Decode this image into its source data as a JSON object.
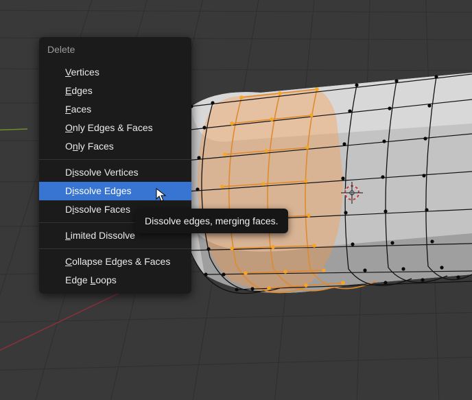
{
  "menu": {
    "title": "Delete",
    "groups": [
      [
        {
          "label": "Vertices",
          "u": [
            0,
            1
          ]
        },
        {
          "label": "Edges",
          "u": [
            0,
            1
          ]
        },
        {
          "label": "Faces",
          "u": [
            0,
            1
          ]
        },
        {
          "label": "Only Edges & Faces",
          "u": [
            0,
            1
          ]
        },
        {
          "label": "Only Faces",
          "u": [
            1,
            2
          ]
        }
      ],
      [
        {
          "label": "Dissolve Vertices",
          "u": [
            1,
            2
          ]
        },
        {
          "label": "Dissolve Edges",
          "u": [
            1,
            2
          ],
          "highlight": true
        },
        {
          "label": "Dissolve Faces",
          "u": [
            1,
            2
          ]
        }
      ],
      [
        {
          "label": "Limited Dissolve",
          "u": [
            0,
            1
          ]
        }
      ],
      [
        {
          "label": "Collapse Edges & Faces",
          "u": [
            0,
            1
          ]
        },
        {
          "label": "Edge Loops",
          "u": [
            5,
            6
          ]
        }
      ]
    ]
  },
  "tooltip": "Dissolve edges, merging faces."
}
